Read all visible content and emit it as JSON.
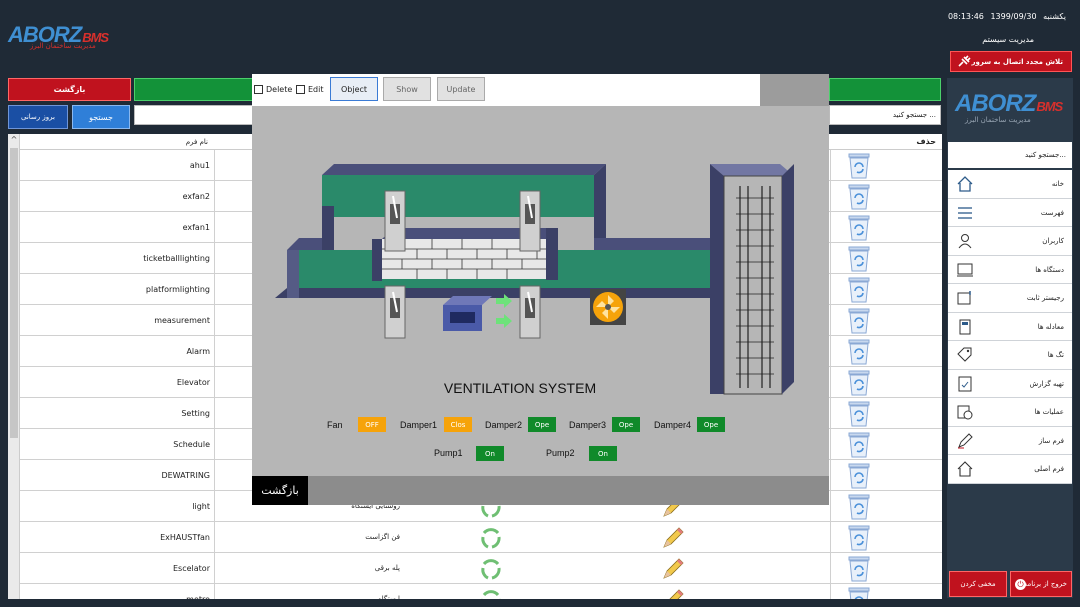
{
  "header": {
    "logo_main": "ABORZ",
    "logo_bms": "BMS",
    "logo_sub": "مدیریت ساختمان البرز",
    "clock_time": "08:13:46",
    "clock_date": "1399/09/30",
    "clock_day": "یکشنبه",
    "system_title": "مدیریت سیستم",
    "reconnect_label": "تلاش مجدد اتصال به سرور"
  },
  "toolbar": {
    "back_label": "بازگشت",
    "search_label": "جستجو",
    "refresh_label": "بروز رسانی",
    "search_placeholder": "جستجو کنید ..."
  },
  "table": {
    "col_name": "نام فرم",
    "col_delete": "حذف",
    "rows": [
      {
        "name": "ahu1",
        "fa": ""
      },
      {
        "name": "exfan2",
        "fa": ""
      },
      {
        "name": "exfan1",
        "fa": ""
      },
      {
        "name": "ticketballlighting",
        "fa": ""
      },
      {
        "name": "platformlighting",
        "fa": ""
      },
      {
        "name": "measurement",
        "fa": ""
      },
      {
        "name": "Alarm",
        "fa": ""
      },
      {
        "name": "Elevator",
        "fa": ""
      },
      {
        "name": "Setting",
        "fa": ""
      },
      {
        "name": "Schedule",
        "fa": ""
      },
      {
        "name": "DEWATRING",
        "fa": ""
      },
      {
        "name": "light",
        "fa": "روشنایی ایستگاه"
      },
      {
        "name": "ExHAUSTfan",
        "fa": "فن اگزاست"
      },
      {
        "name": "Escelator",
        "fa": "پله برقی"
      },
      {
        "name": "motro",
        "fa": "ایستگاه"
      }
    ]
  },
  "sidebar": {
    "search_placeholder": "جستجو کنید...",
    "items": [
      {
        "label": "خانه",
        "icon": "home-icon"
      },
      {
        "label": "فهرست",
        "icon": "list-icon"
      },
      {
        "label": "کاربران",
        "icon": "user-icon"
      },
      {
        "label": "دستگاه ها",
        "icon": "device-icon"
      },
      {
        "label": "رجیستر ثابت",
        "icon": "register-icon"
      },
      {
        "label": "معادله ها",
        "icon": "calculator-icon"
      },
      {
        "label": "تگ ها",
        "icon": "tag-icon"
      },
      {
        "label": "تهیه گزارش",
        "icon": "report-icon"
      },
      {
        "label": "عملیات ها",
        "icon": "operations-icon"
      },
      {
        "label": "فرم ساز",
        "icon": "pen-icon"
      },
      {
        "label": "فرم اصلی",
        "icon": "main-form-icon"
      }
    ],
    "exit_label": "خروج از برنامه",
    "cancel_label": "مخفی کردن"
  },
  "modal": {
    "delete_label": "Delete",
    "edit_label": "Edit",
    "object_label": "Object",
    "show_label": "Show",
    "update_label": "Update",
    "title": "VENTILATION SYSTEM",
    "back_label": "بازگشت",
    "statuses": {
      "fan_label": "Fan",
      "fan_value": "OFF",
      "damper1_label": "Damper1",
      "damper1_value": "Clos",
      "damper2_label": "Damper2",
      "damper2_value": "Ope",
      "damper3_label": "Damper3",
      "damper3_value": "Ope",
      "damper4_label": "Damper4",
      "damper4_value": "Ope",
      "pump1_label": "Pump1",
      "pump1_value": "On",
      "pump2_label": "Pump2",
      "pump2_value": "On"
    }
  },
  "colors": {
    "accent_red": "#c0121e",
    "accent_green": "#139239",
    "status_on": "#108a2a",
    "status_off": "#f6a30a",
    "duct": "#2a8a6a"
  }
}
